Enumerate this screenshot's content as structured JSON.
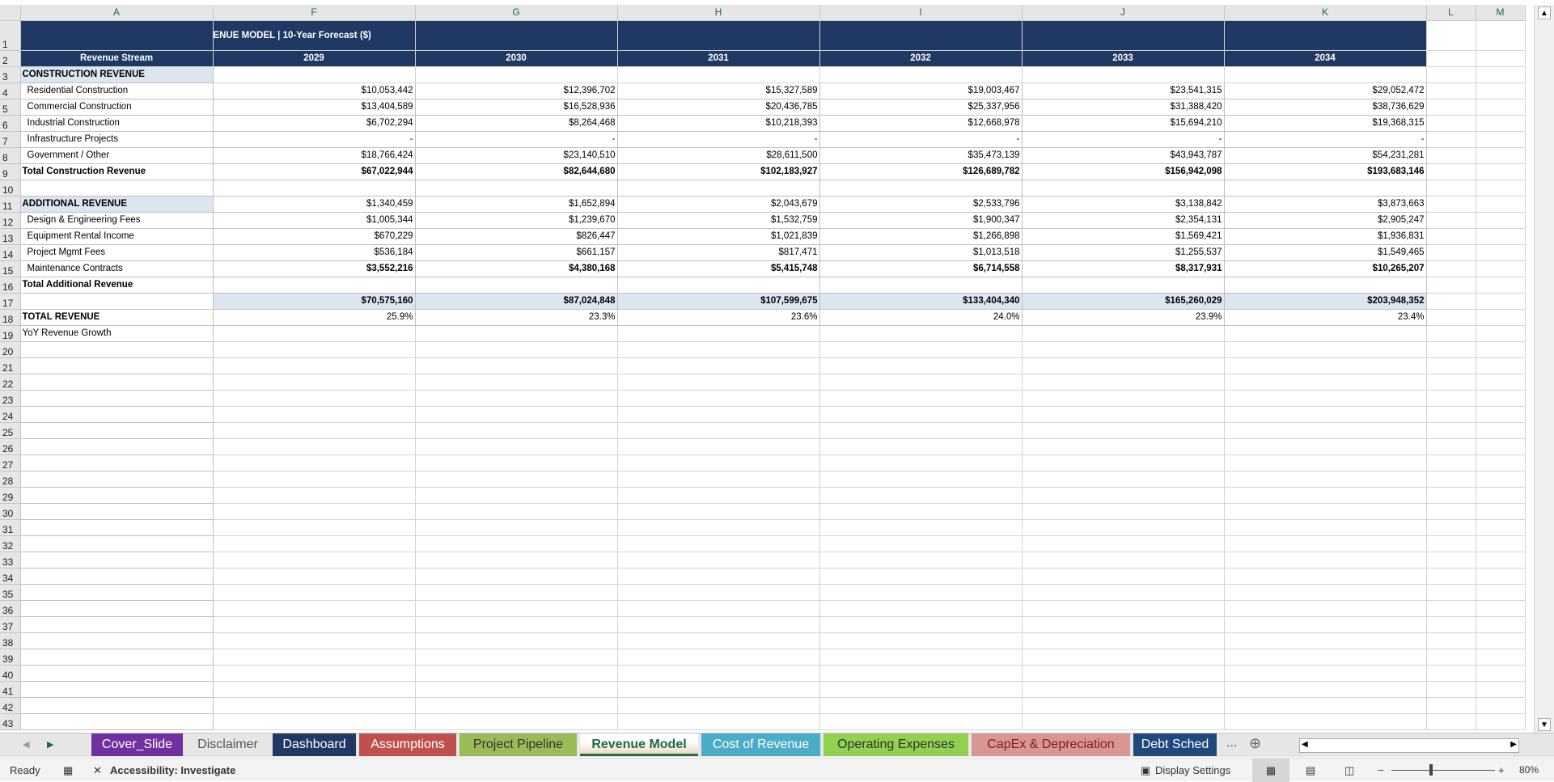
{
  "columns": [
    "A",
    "F",
    "G",
    "H",
    "I",
    "J",
    "K",
    "L",
    "M"
  ],
  "title": "ENUE MODEL  |  10-Year Forecast ($)",
  "header_label": "Revenue Stream",
  "years": [
    "2029",
    "2030",
    "2031",
    "2032",
    "2033",
    "2034"
  ],
  "rows": [
    {
      "n": "3",
      "label": "CONSTRUCTION REVENUE",
      "style": "sec",
      "values": []
    },
    {
      "n": "4",
      "label": "Residential Construction",
      "style": "item",
      "values": [
        "$10,053,442",
        "$12,396,702",
        "$15,327,589",
        "$19,003,467",
        "$23,541,315",
        "$29,052,472"
      ]
    },
    {
      "n": "5",
      "label": "Commercial Construction",
      "style": "item",
      "values": [
        "$13,404,589",
        "$16,528,936",
        "$20,436,785",
        "$25,337,956",
        "$31,388,420",
        "$38,736,629"
      ]
    },
    {
      "n": "6",
      "label": "Industrial Construction",
      "style": "item",
      "values": [
        "$6,702,294",
        "$8,264,468",
        "$10,218,393",
        "$12,668,978",
        "$15,694,210",
        "$19,368,315"
      ]
    },
    {
      "n": "7",
      "label": "Infrastructure Projects",
      "style": "item",
      "values": [
        "-",
        "-",
        "-",
        "-",
        "-",
        "-"
      ]
    },
    {
      "n": "8",
      "label": "Government / Other",
      "style": "item",
      "values": [
        "$18,766,424",
        "$23,140,510",
        "$28,611,500",
        "$35,473,139",
        "$43,943,787",
        "$54,231,281"
      ]
    },
    {
      "n": "9",
      "label": "Total Construction Revenue",
      "style": "total",
      "values": [
        "$67,022,944",
        "$82,644,680",
        "$102,183,927",
        "$126,689,782",
        "$156,942,098",
        "$193,683,146"
      ]
    },
    {
      "n": "10",
      "label": "",
      "style": "blank",
      "values": [
        "",
        "",
        "",
        "",
        "",
        ""
      ]
    },
    {
      "n": "11",
      "label": "ADDITIONAL REVENUE",
      "style": "sec",
      "values": [
        "$1,340,459",
        "$1,652,894",
        "$2,043,679",
        "$2,533,796",
        "$3,138,842",
        "$3,873,663"
      ]
    },
    {
      "n": "12",
      "label": "Design & Engineering Fees",
      "style": "item",
      "values": [
        "$1,005,344",
        "$1,239,670",
        "$1,532,759",
        "$1,900,347",
        "$2,354,131",
        "$2,905,247"
      ]
    },
    {
      "n": "13",
      "label": "Equipment Rental Income",
      "style": "item",
      "values": [
        "$670,229",
        "$826,447",
        "$1,021,839",
        "$1,266,898",
        "$1,569,421",
        "$1,936,831"
      ]
    },
    {
      "n": "14",
      "label": "Project Mgmt Fees",
      "style": "item",
      "values": [
        "$536,184",
        "$661,157",
        "$817,471",
        "$1,013,518",
        "$1,255,537",
        "$1,549,465"
      ]
    },
    {
      "n": "15",
      "label": "Maintenance Contracts",
      "style": "itemboldval",
      "values": [
        "$3,552,216",
        "$4,380,168",
        "$5,415,748",
        "$6,714,558",
        "$8,317,931",
        "$10,265,207"
      ]
    },
    {
      "n": "16",
      "label": "Total Additional Revenue",
      "style": "total",
      "values": [
        "",
        "",
        "",
        "",
        "",
        ""
      ]
    },
    {
      "n": "17",
      "label": "",
      "style": "bluevals",
      "values": [
        "$70,575,160",
        "$87,024,848",
        "$107,599,675",
        "$133,404,340",
        "$165,260,029",
        "$203,948,352"
      ]
    },
    {
      "n": "18",
      "label": "TOTAL REVENUE",
      "style": "total",
      "values": [
        "25.9%",
        "23.3%",
        "23.6%",
        "24.0%",
        "23.9%",
        "23.4%"
      ]
    },
    {
      "n": "19",
      "label": "YoY Revenue Growth",
      "style": "plain",
      "values": []
    }
  ],
  "empty_rows_start": 20,
  "empty_rows_end": 43,
  "tabs": [
    {
      "label": "Cover_Slide",
      "color": "#7030A0"
    },
    {
      "label": "Disclaimer",
      "color": ""
    },
    {
      "label": "Dashboard",
      "color": "#1F3864"
    },
    {
      "label": "Assumptions",
      "color": "#C0504D"
    },
    {
      "label": "Project Pipeline",
      "color": "#9BBB59"
    },
    {
      "label": "Revenue Model",
      "color": "active"
    },
    {
      "label": "Cost of Revenue",
      "color": "#4BACC6"
    },
    {
      "label": "Operating Expenses",
      "color": "#92D050"
    },
    {
      "label": "CapEx & Depreciation",
      "color": "#DA9694"
    },
    {
      "label": "Debt Sched",
      "color": "#1F497D"
    }
  ],
  "tab_more": "...",
  "status": {
    "ready": "Ready",
    "accessibility": "Accessibility: Investigate",
    "display_settings": "Display Settings",
    "zoom": "80%"
  }
}
